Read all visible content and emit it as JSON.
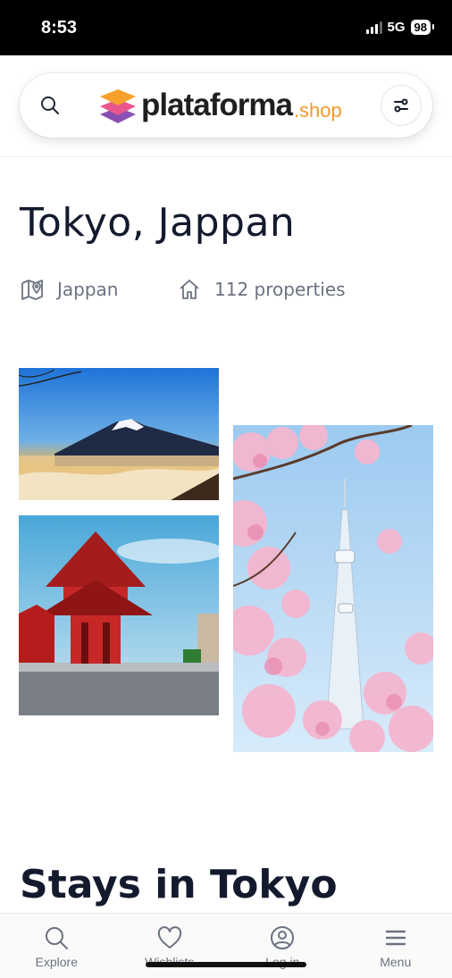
{
  "status_bar": {
    "time": "8:53",
    "network": "5G",
    "battery": "98"
  },
  "header": {
    "search_icon": "search-icon",
    "logo_text": "plataforma",
    "logo_suffix": ".shop",
    "filter_icon": "sliders-icon",
    "brand_colors": {
      "accent": "#f39a2b",
      "layer_top": "#f7a12c",
      "layer_mid": "#e8568b",
      "layer_bottom": "#8a4fb2"
    }
  },
  "destination": {
    "title": "Tokyo, Jappan",
    "country": "Jappan",
    "country_icon": "map-pin-icon",
    "properties": "112 properties",
    "properties_icon": "home-icon"
  },
  "gallery": [
    {
      "subject": "mount-fuji"
    },
    {
      "subject": "red-temple-gate"
    },
    {
      "subject": "skytree-cherry-blossoms"
    }
  ],
  "stays": {
    "title": "Stays in Tokyo"
  },
  "bottom_nav": [
    {
      "label": "Explore",
      "icon": "search-icon"
    },
    {
      "label": "Wishlists",
      "icon": "heart-icon"
    },
    {
      "label": "Log in",
      "icon": "user-circle-icon"
    },
    {
      "label": "Menu",
      "icon": "menu-icon"
    }
  ]
}
